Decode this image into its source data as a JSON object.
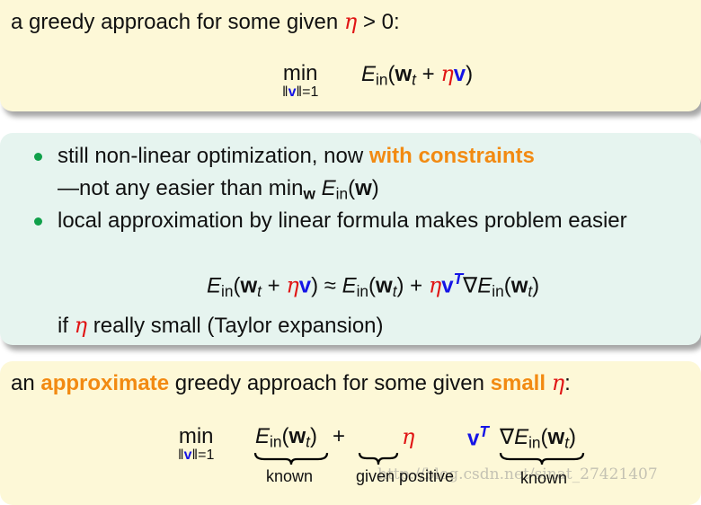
{
  "block1": {
    "intro": [
      [
        "a greedy approach for some given ",
        ""
      ],
      [
        "η",
        "red"
      ],
      [
        " > 0:",
        ""
      ]
    ],
    "min_label": "min",
    "min_limit": [
      [
        "‖",
        ""
      ],
      [
        "v",
        "blue"
      ],
      [
        "‖=1",
        ""
      ]
    ],
    "objective": [
      [
        "E",
        "it"
      ],
      [
        "in",
        "sub"
      ],
      [
        "(",
        ""
      ],
      [
        "w",
        "bold"
      ],
      [
        "t",
        "sub it"
      ],
      [
        " + ",
        ""
      ],
      [
        "η",
        "red"
      ],
      [
        "v",
        "blue"
      ],
      [
        ")",
        ""
      ]
    ]
  },
  "block2": {
    "bullet1": [
      [
        "still non-linear optimization, now ",
        ""
      ],
      [
        "with constraints",
        "orange"
      ]
    ],
    "bullet1_cont": [
      [
        "—not any easier than min",
        ""
      ],
      [
        "w",
        "sub bold"
      ],
      [
        " ",
        ""
      ],
      [
        "E",
        "it"
      ],
      [
        "in",
        "sub"
      ],
      [
        "(",
        ""
      ],
      [
        "w",
        "bold"
      ],
      [
        ")",
        ""
      ]
    ],
    "bullet2": [
      [
        "local approximation by linear formula makes problem easier",
        ""
      ]
    ],
    "taylor": [
      [
        "E",
        "it"
      ],
      [
        "in",
        "sub"
      ],
      [
        "(",
        ""
      ],
      [
        "w",
        "bold"
      ],
      [
        "t",
        "sub it"
      ],
      [
        " + ",
        ""
      ],
      [
        "η",
        "red"
      ],
      [
        "v",
        "blue"
      ],
      [
        ") ≈ ",
        ""
      ],
      [
        "E",
        "it"
      ],
      [
        "in",
        "sub"
      ],
      [
        "(",
        ""
      ],
      [
        "w",
        "bold"
      ],
      [
        "t",
        "sub it"
      ],
      [
        ") + ",
        ""
      ],
      [
        "η",
        "red"
      ],
      [
        "v",
        "blue"
      ],
      [
        "T",
        "sup blue it"
      ],
      [
        "∇",
        ""
      ],
      [
        "E",
        "it"
      ],
      [
        "in",
        "sub"
      ],
      [
        "(",
        ""
      ],
      [
        "w",
        "bold"
      ],
      [
        "t",
        "sub it"
      ],
      [
        ")",
        ""
      ]
    ],
    "condition": [
      [
        "if ",
        ""
      ],
      [
        "η",
        "red"
      ],
      [
        " really small (Taylor expansion)",
        ""
      ]
    ]
  },
  "block3": {
    "intro": [
      [
        "an ",
        ""
      ],
      [
        "approximate",
        "orange"
      ],
      [
        " greedy approach for some given ",
        ""
      ],
      [
        "small",
        "orange"
      ],
      [
        " ",
        ""
      ],
      [
        "η",
        "red"
      ],
      [
        ":",
        ""
      ]
    ],
    "min_label": "min",
    "min_limit": [
      [
        "‖",
        ""
      ],
      [
        "v",
        "blue"
      ],
      [
        "‖=1",
        ""
      ]
    ],
    "term1": [
      [
        "E",
        "it"
      ],
      [
        "in",
        "sub"
      ],
      [
        "(",
        ""
      ],
      [
        "w",
        "bold"
      ],
      [
        "t",
        "sub it"
      ],
      [
        ")",
        ""
      ]
    ],
    "plus": "+",
    "term2": [
      [
        "η",
        "red"
      ]
    ],
    "term3a": [
      [
        "v",
        "blue"
      ],
      [
        "T",
        "sup blue it"
      ]
    ],
    "term3b": [
      [
        "∇",
        ""
      ],
      [
        "E",
        "it"
      ],
      [
        "in",
        "sub"
      ],
      [
        "(",
        ""
      ],
      [
        "w",
        "bold"
      ],
      [
        "t",
        "sub it"
      ],
      [
        ")",
        ""
      ]
    ],
    "label_known_1": "known",
    "label_given_positive": "given positive",
    "label_known_2": "known",
    "watermark": "http://blog.csdn.net/sinat_27421407"
  },
  "colors": {
    "highlight": "#f28a12",
    "eta": "#e01414",
    "vector": "#1414e6",
    "bullet": "#10a04a",
    "box_yellow": "#fdf8d7",
    "box_green": "#e6f4ef"
  }
}
